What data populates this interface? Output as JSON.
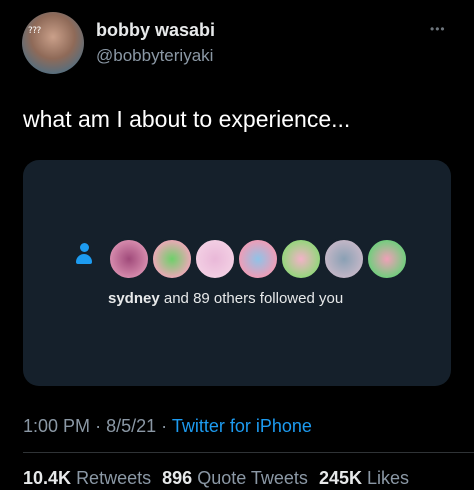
{
  "author": {
    "display_name": "bobby wasabi",
    "handle": "@bobbyteriyaki",
    "avatar_tag": "???",
    "avatar_icon": "profile-photo"
  },
  "menu": {
    "more_label": "•••"
  },
  "tweet": {
    "text": "what am I about to experience..."
  },
  "card": {
    "icon": "person-icon",
    "follower_name": "sydney",
    "follow_text": "and 89 others followed you",
    "follower_avatars": [
      {
        "inner": "#a04a7a",
        "outer": "#d98fb0"
      },
      {
        "inner": "#6ed06a",
        "outer": "#f2a7bb"
      },
      {
        "inner": "#e9b8d8",
        "outer": "#f3d0e4"
      },
      {
        "inner": "#8fc3e8",
        "outer": "#f49bb4"
      },
      {
        "inner": "#f3b2c8",
        "outer": "#8fd878"
      },
      {
        "inner": "#8aa0b4",
        "outer": "#c6b8c8"
      },
      {
        "inner": "#f0a0b8",
        "outer": "#6ad07a"
      }
    ]
  },
  "meta": {
    "time": "1:00 PM",
    "date": "8/5/21",
    "separator": "·",
    "source": "Twitter for iPhone"
  },
  "stats": {
    "retweets_count": "10.4K",
    "retweets_label": "Retweets",
    "quotes_count": "896",
    "quotes_label": "Quote Tweets",
    "likes_count": "245K",
    "likes_label": "Likes"
  }
}
